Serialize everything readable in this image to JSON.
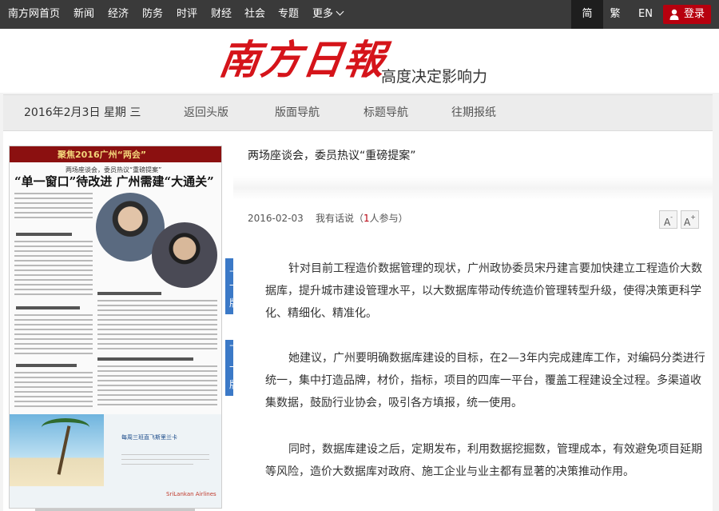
{
  "topnav": {
    "links": [
      "南方网首页",
      "新闻",
      "经济",
      "防务",
      "时评",
      "财经",
      "社会",
      "专题",
      "更多"
    ],
    "langs": [
      "简",
      "繁",
      "EN"
    ],
    "login": "登录"
  },
  "masthead": {
    "logo_text": "南方日報",
    "slogan": "高度决定影响力"
  },
  "datebar": {
    "date": "2016年2月3日 星期 三",
    "nav": [
      "返回头版",
      "版面导航",
      "标题导航",
      "往期报纸"
    ]
  },
  "paper": {
    "banner": "聚焦2016广州“两会”",
    "kicker": "两场座谈会，委员热议“重磅提案”",
    "headline": "“单一窗口”待改进 广州需建“大通关”",
    "ad_text": "每周三班直飞斯里兰卡",
    "ad_brand": "SriLankan Airlines"
  },
  "pagetabs": {
    "prev": [
      "上",
      "一",
      "版"
    ],
    "next": [
      "下",
      "一",
      "版"
    ]
  },
  "article": {
    "title": "两场座谈会，委员热议“重磅提案”",
    "date": "2016-02-03",
    "comment_prefix": "我有话说（",
    "comment_count": "1",
    "comment_suffix": "人参与）",
    "font_decrease": "A",
    "font_increase": "A",
    "paragraphs": [
      "针对目前工程造价数据管理的现状，广州政协委员宋丹建言要加快建立工程造价大数据库，提升城市建设管理水平，以大数据库带动传统造价管理转型升级，使得决策更科学化、精细化、精准化。",
      "她建议，广州要明确数据库建设的目标，在2—3年内完成建库工作，对编码分类进行统一，集中打造品牌，材价，指标，项目的四库一平台，覆盖工程建设全过程。多渠道收集数据，鼓励行业协会，吸引各方填报，统一使用。",
      "同时，数据库建设之后，定期发布，利用数据挖掘数，管理成本，有效避免项目延期等风险，造价大数据库对政府、施工企业与业主都有显著的决策推动作用。"
    ]
  }
}
